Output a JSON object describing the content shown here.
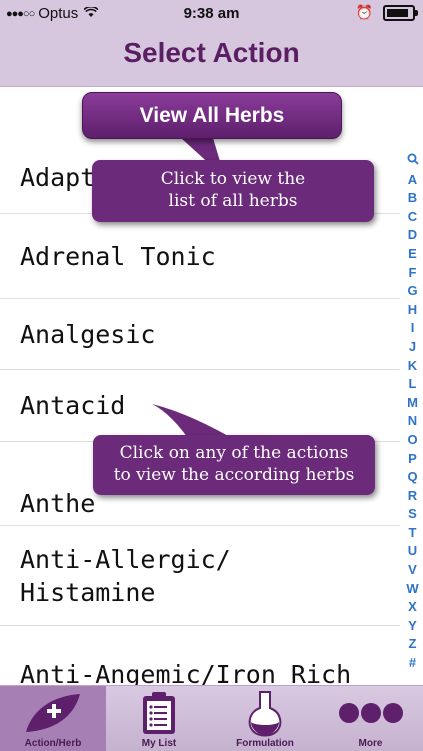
{
  "status_bar": {
    "carrier": "Optus",
    "time": "9:38 am"
  },
  "nav": {
    "title": "Select Action"
  },
  "list": {
    "items": [
      {
        "label": "Adapt"
      },
      {
        "label": "Adrenal Tonic"
      },
      {
        "label": "Analgesic"
      },
      {
        "label": "Antacid"
      },
      {
        "label": "Anthe"
      },
      {
        "label": "Anti-Allergic/"
      },
      {
        "label": "Histamine"
      },
      {
        "label": "Anti-Angemic/Iron Rich"
      }
    ]
  },
  "index": {
    "letters": [
      "Q",
      "A",
      "B",
      "C",
      "D",
      "E",
      "F",
      "G",
      "H",
      "I",
      "J",
      "K",
      "L",
      "M",
      "N",
      "O",
      "P",
      "Q",
      "R",
      "S",
      "T",
      "U",
      "V",
      "W",
      "X",
      "Y",
      "Z",
      "#"
    ]
  },
  "overlay": {
    "view_all_button": "View All Herbs",
    "callout_view_all_line1": "Click to view the",
    "callout_view_all_line2": "list of all herbs",
    "callout_actions_line1": "Click on any of the actions",
    "callout_actions_line2": "to view the according herbs"
  },
  "tabs": [
    {
      "label": "Action/Herb",
      "icon": "leaf-plus-icon",
      "active": true
    },
    {
      "label": "My List",
      "icon": "clipboard-icon",
      "active": false
    },
    {
      "label": "Formulation",
      "icon": "flask-icon",
      "active": false
    },
    {
      "label": "More",
      "icon": "more-dots-icon",
      "active": false
    }
  ],
  "colors": {
    "bar_bg": "#d6c6de",
    "title_purple": "#5a1e63",
    "callout_purple": "#6c2a7b",
    "index_blue": "#2f74c8",
    "active_tab": "#a67fb5"
  }
}
